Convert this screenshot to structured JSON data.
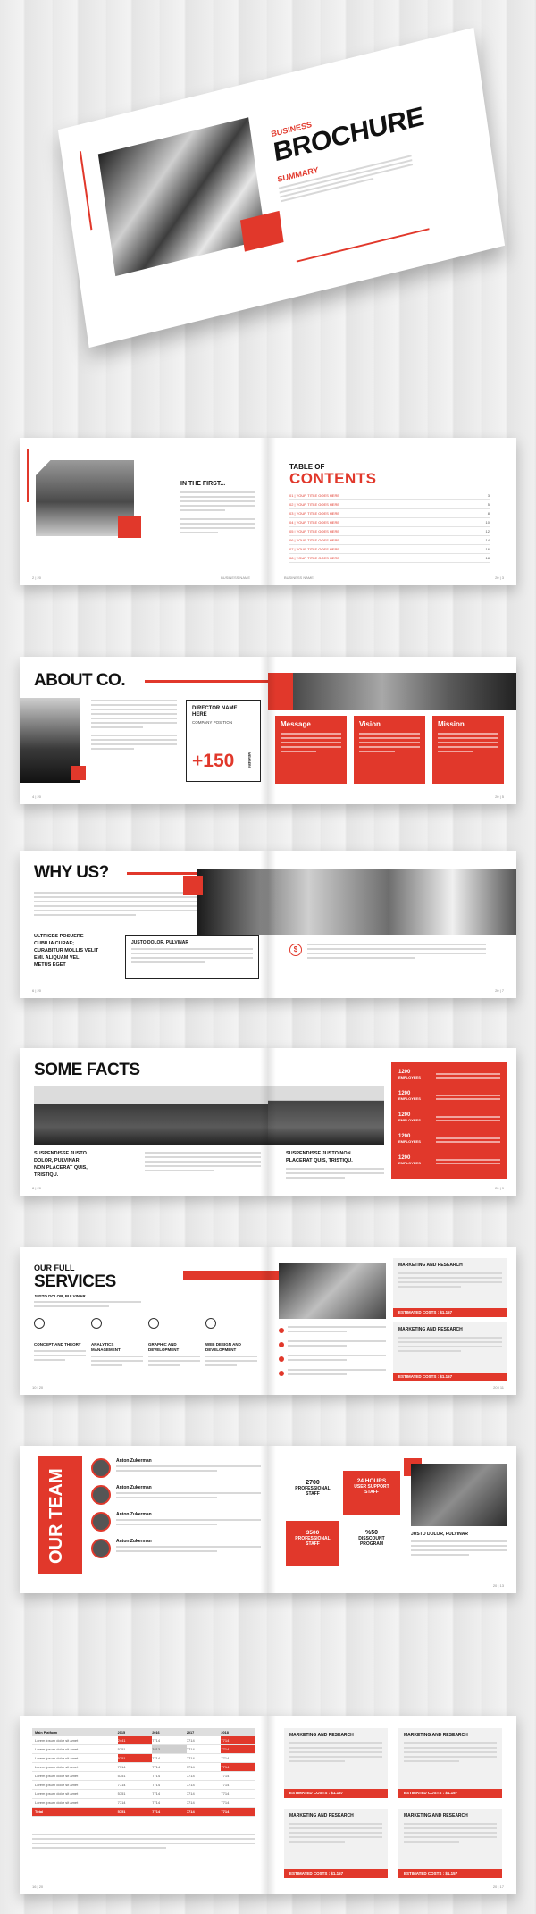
{
  "colors": {
    "accent": "#e1382b",
    "dark": "#111111"
  },
  "cover": {
    "eyebrow": "BUSINESS",
    "title": "BROCHURE",
    "summary_label": "SUMMARY"
  },
  "spread2": {
    "in_the_first": "IN THE FIRST...",
    "toc_label": "TABLE OF",
    "toc_title": "CONTENTS",
    "toc_items": [
      {
        "label": "01 | YOUR TITLE GOES HERE",
        "page": "3"
      },
      {
        "label": "02 | YOUR TITLE GOES HERE",
        "page": "5"
      },
      {
        "label": "03 | YOUR TITLE GOES HERE",
        "page": "8"
      },
      {
        "label": "04 | YOUR TITLE GOES HERE",
        "page": "10"
      },
      {
        "label": "05 | YOUR TITLE GOES HERE",
        "page": "12"
      },
      {
        "label": "06 | YOUR TITLE GOES HERE",
        "page": "14"
      },
      {
        "label": "07 | YOUR TITLE GOES HERE",
        "page": "16"
      },
      {
        "label": "08 | YOUR TITLE GOES HERE",
        "page": "18"
      }
    ],
    "folio_left": "2 | 20",
    "folio_right": "20 | 3",
    "brand_left": "BUSINESS NAME",
    "brand_right": "BUSINESS NAME"
  },
  "spread3": {
    "title": "ABOUT CO.",
    "director_name": "DIRECTOR NAME HERE",
    "director_pos": "COMPANY POSITION",
    "big_number": "+150",
    "big_number_label": "MEMBERS",
    "cards": [
      "Message",
      "Vision",
      "Mission"
    ],
    "folio_left": "4 | 20",
    "folio_right": "20 | 5"
  },
  "spread4": {
    "title": "WHY US?",
    "list": "ULTRICES POSUERE\nCUBILIA CURAE;\nCURABITUR MOLLIS VELIT\nEMI. ALIQUAM VEL\nMETUS EGET",
    "sub": "JUSTO DOLOR, PULVINAR",
    "folio_left": "6 | 20",
    "folio_right": "20 | 7"
  },
  "spread5": {
    "title": "SOME FACTS",
    "left_sub": "SUSPENDISSE JUSTO\nDOLOR, PULVINAR\nNON PLACERAT QUIS,\nTRISTIQU.",
    "right_sub": "SUSPENDISSE JUSTO NON\nPLACERAT QUIS, TRISTIQU.",
    "stats": [
      {
        "num": "1200",
        "label": "EMPLOYEES"
      },
      {
        "num": "1200",
        "label": "EMPLOYEES"
      },
      {
        "num": "1200",
        "label": "EMPLOYEES"
      },
      {
        "num": "1200",
        "label": "EMPLOYEES"
      },
      {
        "num": "1200",
        "label": "EMPLOYEES"
      }
    ],
    "folio_left": "8 | 20",
    "folio_right": "20 | 9"
  },
  "spread6": {
    "eyebrow": "OUR FULL",
    "title": "SERVICES",
    "sub": "JUSTO DOLOR, PULVINAR",
    "services": [
      {
        "icon": "gear-icon",
        "label": "CONCEPT AND THEORY"
      },
      {
        "icon": "cog-icon",
        "label": "ANALYTICS MANAGEMENT"
      },
      {
        "icon": "person-icon",
        "label": "GRAPHIC AND DEVELOPMENT"
      },
      {
        "icon": "chart-icon",
        "label": "WEB DESIGN AND DEVELOPMENT"
      }
    ],
    "right_box1": "MARKETING AND RESEARCH",
    "right_box2": "MARKETING AND RESEARCH",
    "cost": "ESTIMATED COSTS : $1.157",
    "folio_left": "10 | 20",
    "folio_right": "20 | 11"
  },
  "spread7": {
    "title": "OUR TEAM",
    "members": [
      "Anton Zukerman",
      "Anton Zukerman",
      "Anton Zukerman",
      "Anton Zukerman"
    ],
    "stat_cells": [
      {
        "num": "2700",
        "label": "PROFESSIONAL\nSTAFF",
        "red": false
      },
      {
        "num": "24 HOURS",
        "label": "USER SUPPORT\nSTAFF",
        "red": true
      },
      {
        "num": "3500",
        "label": "PROFESSIONAL\nSTAFF",
        "red": true
      },
      {
        "num": "%50",
        "label": "DISSCOUNT\nPROGRAM",
        "red": false
      }
    ],
    "right_sub": "JUSTO DOLOR, PULVINAR",
    "folio_left": "12 | 20",
    "folio_right": "20 | 13"
  },
  "spread8": {
    "table_head": [
      "Main Platform",
      "2015",
      "2016",
      "2017",
      "2018"
    ],
    "table_rows": [
      [
        "Lorem ipsum dolor sit amet",
        "2441",
        "7714",
        "7714",
        "7714"
      ],
      [
        "Lorem ipsum dolor sit amet",
        "5751",
        "3813",
        "7714",
        "7714"
      ],
      [
        "Lorem ipsum dolor sit amet",
        "5751",
        "7714",
        "7714",
        "7714"
      ],
      [
        "Lorem ipsum dolor sit amet",
        "7714",
        "7714",
        "7714",
        "7714"
      ],
      [
        "Lorem ipsum dolor sit amet",
        "5751",
        "7714",
        "7714",
        "7714"
      ],
      [
        "Lorem ipsum dolor sit amet",
        "7714",
        "7714",
        "7714",
        "7714"
      ],
      [
        "Lorem ipsum dolor sit amet",
        "5751",
        "7714",
        "7714",
        "7714"
      ],
      [
        "Lorem ipsum dolor sit amet",
        "7714",
        "7714",
        "7714",
        "7714"
      ],
      [
        "Total",
        "5751",
        "7714",
        "7714",
        "7714"
      ]
    ],
    "right_boxes": [
      "MARKETING AND RESEARCH",
      "MARKETING AND RESEARCH",
      "MARKETING AND RESEARCH",
      "MARKETING AND RESEARCH"
    ],
    "cost": "ESTIMATED COSTS : $1.157",
    "folio_left": "16 | 20",
    "folio_right": "20 | 17"
  }
}
